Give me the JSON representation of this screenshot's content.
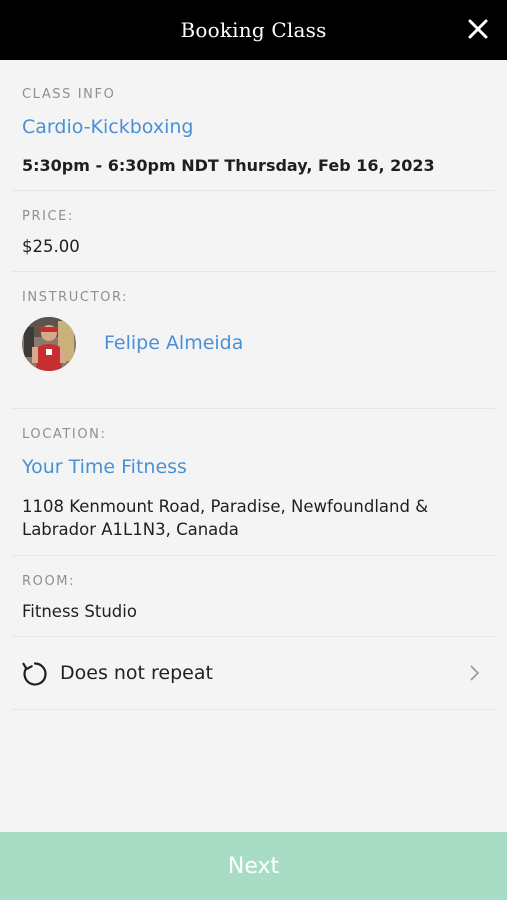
{
  "header": {
    "title": "Booking Class",
    "close_icon": "close-icon"
  },
  "class_info": {
    "label": "CLASS INFO",
    "name": "Cardio-Kickboxing",
    "datetime": "5:30pm - 6:30pm NDT Thursday, Feb 16, 2023"
  },
  "price": {
    "label": "PRICE:",
    "value": "$25.00"
  },
  "instructor": {
    "label": "INSTRUCTOR:",
    "name": "Felipe Almeida"
  },
  "location": {
    "label": "LOCATION:",
    "name": "Your Time Fitness",
    "address_line1": "1108 Kenmount Road, Paradise, Newfoundland &",
    "address_line2": "Labrador A1L1N3, Canada"
  },
  "room": {
    "label": "ROOM:",
    "value": "Fitness Studio"
  },
  "repeat": {
    "label": "Does not repeat",
    "icon": "repeat-icon",
    "chevron": "chevron-right-icon"
  },
  "footer": {
    "next_label": "Next"
  },
  "colors": {
    "accent": "#4a90d9",
    "next_bg": "#a9dcc5",
    "header_bg": "#000000"
  }
}
